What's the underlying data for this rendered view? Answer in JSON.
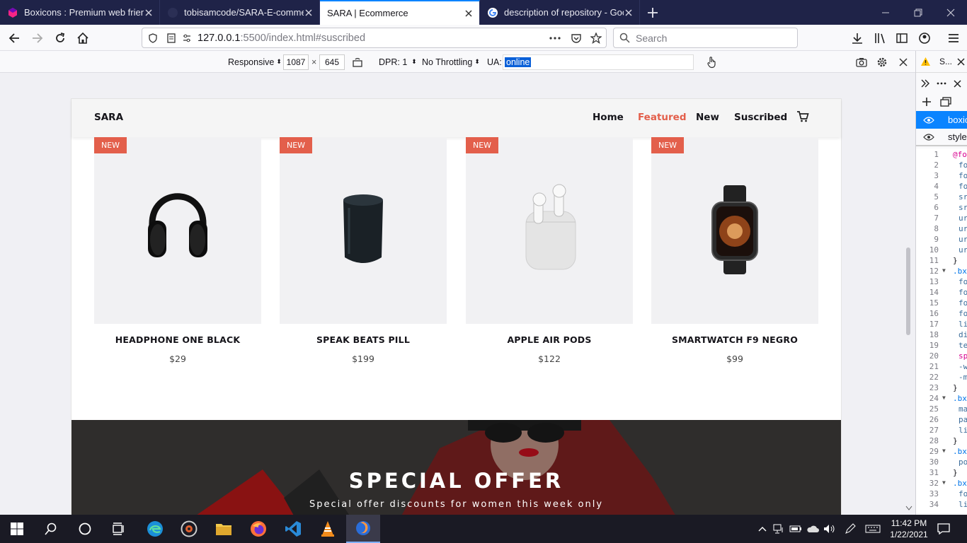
{
  "browser": {
    "tabs": [
      {
        "title": "Boxicons : Premium web friendly icons",
        "active": false
      },
      {
        "title": "tobisamcode/SARA-E-commerce",
        "active": false
      },
      {
        "title": "SARA | Ecommerce",
        "active": true
      },
      {
        "title": "description of repository - Google Search",
        "active": false
      }
    ],
    "url_host": "127.0.0.1",
    "url_path": ":5500/index.html#suscribed",
    "search_placeholder": "Search"
  },
  "rdm": {
    "device": "Responsive",
    "width": "1087",
    "times": "×",
    "height": "645",
    "dpr": "DPR: 1",
    "throttling": "No Throttling",
    "ua_label": "UA:",
    "ua_value": "online"
  },
  "site": {
    "logo": "SARA",
    "nav": [
      "Home",
      "Featured",
      "New",
      "Suscribed"
    ],
    "active_nav": "Featured",
    "accent": "#e35f4b",
    "products": [
      {
        "badge": "NEW",
        "name": "HEADPHONE ONE BLACK",
        "price": "$29",
        "icon": "headphone-image"
      },
      {
        "badge": "NEW",
        "name": "SPEAK BEATS PILL",
        "price": "$199",
        "icon": "speaker-image"
      },
      {
        "badge": "NEW",
        "name": "APPLE AIR PODS",
        "price": "$122",
        "icon": "airpods-image"
      },
      {
        "badge": "NEW",
        "name": "SMARTWATCH F9 NEGRO",
        "price": "$99",
        "icon": "smartwatch-image"
      }
    ],
    "offer": {
      "heading": "SPECIAL OFFER",
      "subheading": "Special offer discounts for women this week only"
    }
  },
  "devtools": {
    "sheets": [
      "boxicons",
      "style."
    ],
    "line_numbers": [
      "1",
      "2",
      "3",
      "4",
      "5",
      "6",
      "7",
      "8",
      "9",
      "10",
      "11",
      "12",
      "13",
      "14",
      "15",
      "16",
      "17",
      "18",
      "19",
      "20",
      "21",
      "22",
      "23",
      "24",
      "25",
      "26",
      "27",
      "28",
      "29",
      "30",
      "31",
      "32",
      "33",
      "34"
    ],
    "code": [
      "@fo",
      "fo",
      "fo",
      "fo",
      "sr",
      "sr",
      "ur",
      "ur",
      "ur",
      "ur",
      "}",
      ".bx",
      "fo",
      "fo",
      "fo",
      "fo",
      "li",
      "di",
      "te",
      "sp",
      "-w",
      "-m",
      "}",
      ".bx",
      "ma",
      "pa",
      "li",
      "}",
      ".bx",
      "po",
      "}",
      ".bx",
      "fo",
      "li"
    ]
  },
  "taskbar": {
    "time": "11:42 PM",
    "date": "1/22/2021"
  }
}
